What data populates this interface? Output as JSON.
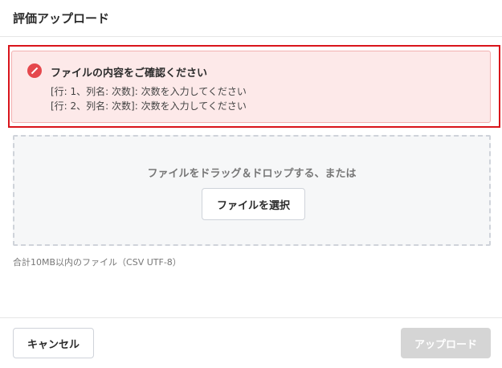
{
  "dialog": {
    "title": "評価アップロード"
  },
  "alert": {
    "icon": "error-icon",
    "title": "ファイルの内容をご確認ください",
    "messages": [
      "[行: 1、列名: 次数]: 次数を入力してください",
      "[行: 2、列名: 次数]: 次数を入力してください"
    ]
  },
  "dropzone": {
    "text": "ファイルをドラッグ＆ドロップする、または",
    "select_label": "ファイルを選択"
  },
  "file_hint": "合計10MB以内のファイル（CSV UTF-8）",
  "footer": {
    "cancel_label": "キャンセル",
    "upload_label": "アップロード",
    "upload_enabled": false
  },
  "colors": {
    "highlight": "#d9141b",
    "alert_bg": "#fde9e9",
    "alert_icon": "#e5484d",
    "disabled_button": "#d5d5d5"
  }
}
